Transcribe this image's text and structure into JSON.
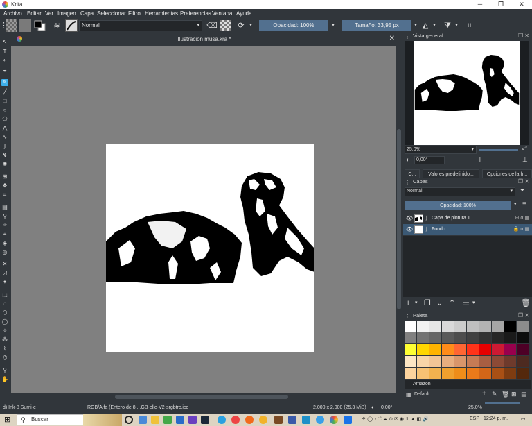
{
  "window": {
    "title": "Krita",
    "minimize": "─",
    "maximize": "❐",
    "close": "✕"
  },
  "menu": [
    "Archivo",
    "Editar",
    "Ver",
    "Imagen",
    "Capa",
    "Seleccionar",
    "Filtro",
    "Herramientas",
    "Preferencias",
    "Ventana",
    "Ayuda"
  ],
  "toolbar": {
    "blend_mode": "Normal",
    "opacity": "Opacidad: 100%",
    "size": "Tamaño: 33,95 px"
  },
  "document": {
    "tab_title": "Ilustracion musa.kra *",
    "close": "✕"
  },
  "overview": {
    "title": "Vista general",
    "zoom": "25,0%",
    "rotation": "0,00°"
  },
  "panel_tabs": [
    "C...",
    "Valores predefinido...",
    "Opciones de la h..."
  ],
  "layers": {
    "title": "Capas",
    "blend_mode": "Normal",
    "opacity": "Opacidad:  100%",
    "items": [
      {
        "name": "Capa de pintura 1",
        "selected": false,
        "flags": "⊞ α ▦"
      },
      {
        "name": "Fondo",
        "selected": true,
        "flags": "🔒 α ▦"
      }
    ]
  },
  "palette": {
    "title": "Paleta",
    "name": "Amazon",
    "set": "Default",
    "colors": [
      "#ffffff",
      "#f2f2f2",
      "#e6e6e6",
      "#d9d9d9",
      "#cccccc",
      "#bfbfbf",
      "#b3b3b3",
      "#a6a6a6",
      "#000000",
      "#8c8c8c",
      "#808080",
      "#737373",
      "#666666",
      "#595959",
      "#4d4d4d",
      "#404040",
      "#333333",
      "#262626",
      "#1a1a1a",
      "#0d0d0d",
      "#ffff33",
      "#ffd600",
      "#ffb300",
      "#ff8c1a",
      "#ff6633",
      "#ff3319",
      "#e60000",
      "#cc1a33",
      "#99004d",
      "#4d0026",
      "#fde6c4",
      "#f8d5a8",
      "#f2c596",
      "#e8ae7f",
      "#d9966b",
      "#c67b55",
      "#a85e42",
      "#8c4a36",
      "#6e3a2c",
      "#4d2a20",
      "#fcd49e",
      "#f7c274",
      "#f2b24f",
      "#f0a02e",
      "#ee8d1a",
      "#ea7a1a",
      "#d36618",
      "#a95015",
      "#7e3c11",
      "#54280c"
    ]
  },
  "status": {
    "brush": "d) Ink-8 Sumi-e",
    "colorspace": "RGB/Alfa (Entero de 8 ...GB-elle-V2-srgbtrc.icc",
    "dimensions": "2.000 x 2.000 (25,3 MiB)",
    "rotation": "0,00°",
    "zoom": "25,0%"
  },
  "taskbar": {
    "search": "Buscar",
    "language": "ESP",
    "time": "12:24 p. m."
  }
}
